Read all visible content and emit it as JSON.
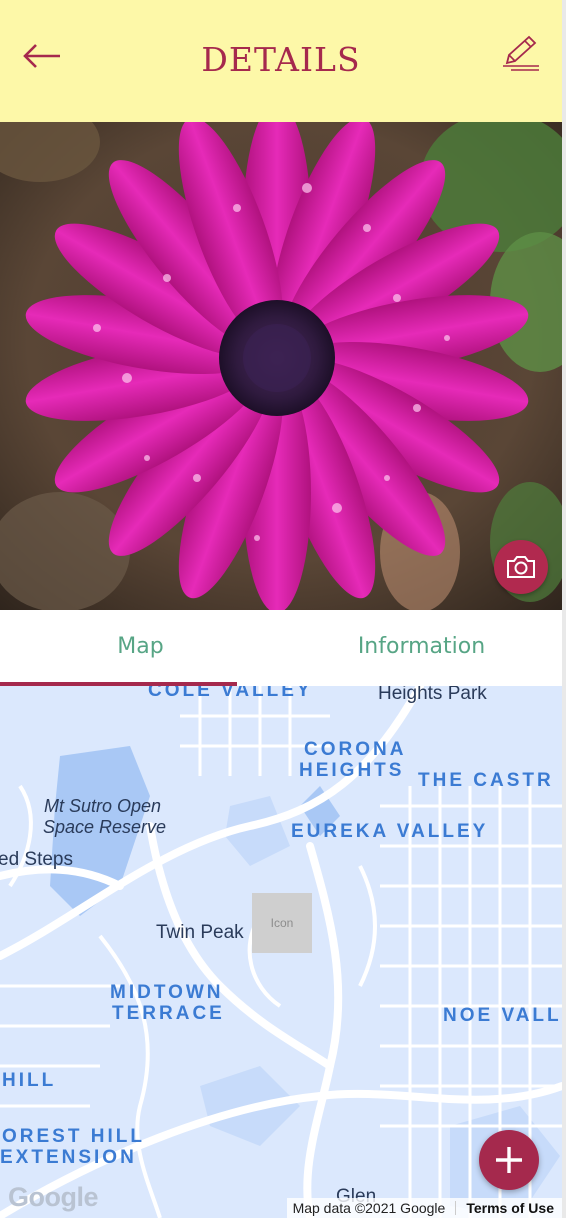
{
  "header": {
    "title": "DETAILS",
    "back_icon": "arrow-left-icon",
    "edit_icon": "pencil-icon",
    "accent": "#a5294d",
    "background": "#fdf8a8"
  },
  "photo": {
    "camera_icon": "camera-icon"
  },
  "tabs": [
    {
      "label": "Map",
      "selected": true
    },
    {
      "label": "Information",
      "selected": false
    }
  ],
  "map": {
    "labels": {
      "cole_valley": "COLE VALLEY",
      "heights_park": "Heights Park",
      "corona_heights_1": "CORONA",
      "corona_heights_2": "HEIGHTS",
      "the_castro": "THE CASTR",
      "mt_sutro_1": "Mt Sutro Open",
      "mt_sutro_2": "Space Reserve",
      "eureka_valley": "EUREKA VALLEY",
      "steps": "ed Steps",
      "twin_peaks": "Twin Peak",
      "midtown_1": "MIDTOWN",
      "midtown_2": "TERRACE",
      "noe_valley": "NOE VALL",
      "hill": "HILL",
      "forest_hill_1": "OREST HILL",
      "forest_hill_2": "EXTENSION",
      "glen": "Glen"
    },
    "marker_text": "Icon",
    "add_icon": "plus-icon",
    "google_logo": "Google",
    "attribution": "Map data ©2021 Google",
    "terms": "Terms of Use"
  }
}
